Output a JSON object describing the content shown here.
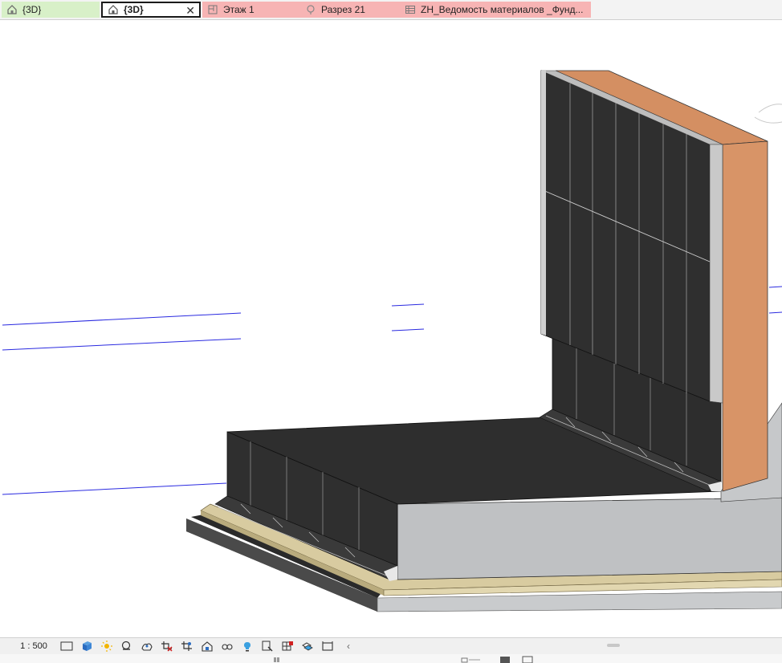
{
  "tabs": [
    {
      "label": "{3D}",
      "icon": "home-3d-icon"
    },
    {
      "label": "{3D}",
      "icon": "home-3d-icon",
      "active": true,
      "close": "✕"
    },
    {
      "label": "Этаж 1",
      "icon": "floor-plan-icon"
    },
    {
      "label": "Разрез 21",
      "icon": "section-icon"
    },
    {
      "label": "ZH_Ведомость материалов _Фунд...",
      "icon": "schedule-icon"
    }
  ],
  "status": {
    "scale": "1 : 500",
    "tools": [
      "detail-level-icon",
      "visual-style-cube-icon",
      "sun-path-icon",
      "shadows-icon",
      "render-icon",
      "crop-view-icon",
      "show-crop-region-icon",
      "unlock-3d-view-icon",
      "temporary-hide-icon",
      "reveal-hidden-icon",
      "worksharing-display-icon",
      "analytical-model-icon",
      "highlight-displacement-icon",
      "reveal-constraints-icon"
    ]
  },
  "colors": {
    "tab_green": "#d8f0c8",
    "tab_pink": "#f7b4b4",
    "wall_dark": "#2f2f2f",
    "concrete": "#bfc1c3",
    "brick_face": "#d48f62",
    "sand_layer": "#d8cba0",
    "grid_line": "#2a2ae0"
  }
}
